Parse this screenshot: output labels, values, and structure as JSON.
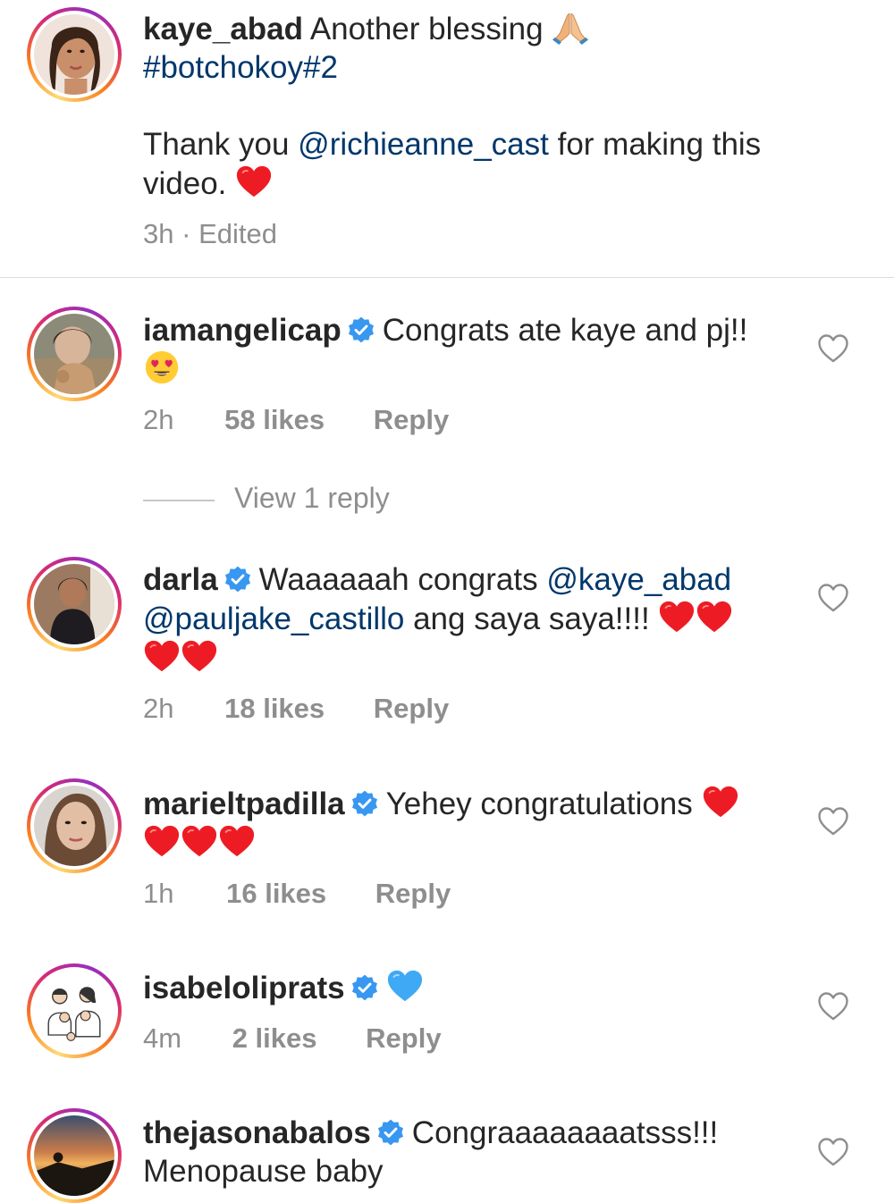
{
  "caption": {
    "username": "kaye_abad",
    "text": "Another blessing",
    "emoji": "folded-hands",
    "hashtag": "#botchokoy#2",
    "thanks_prefix": "Thank you",
    "thanks_mention": "@richieanne_cast",
    "thanks_suffix": "for making this",
    "thanks_line2": "video.",
    "thanks_emoji": "red-heart",
    "time": "3h",
    "separator": "·",
    "edited": "Edited"
  },
  "comments": [
    {
      "username": "iamangelicap",
      "verified": true,
      "text": "Congrats ate kaye and pj!!",
      "emojis": [
        "heart-eyes"
      ],
      "time": "2h",
      "likes": "58 likes",
      "reply": "Reply",
      "view_replies": "View 1 reply"
    },
    {
      "username": "darla",
      "verified": true,
      "text_prefix": "Waaaaaah congrats",
      "mention1": "@kaye_abad",
      "mention2": "@pauljake_castillo",
      "text_suffix": "ang saya saya!!!!",
      "emojis": [
        "red-heart",
        "red-heart",
        "red-heart",
        "red-heart"
      ],
      "time": "2h",
      "likes": "18 likes",
      "reply": "Reply"
    },
    {
      "username": "marieltpadilla",
      "verified": true,
      "text": "Yehey congratulations",
      "emojis": [
        "red-heart",
        "red-heart",
        "red-heart",
        "red-heart"
      ],
      "time": "1h",
      "likes": "16 likes",
      "reply": "Reply"
    },
    {
      "username": "isabeloliprats",
      "verified": true,
      "text": "",
      "emojis": [
        "blue-heart"
      ],
      "time": "4m",
      "likes": "2 likes",
      "reply": "Reply"
    },
    {
      "username": "thejasonabalos",
      "verified": true,
      "text": "Congraaaaaaaatsss!!!",
      "text_line2": "Menopause baby"
    }
  ],
  "colors": {
    "link": "#00376b",
    "meta": "#8e8e8e",
    "verified": "#3897f0",
    "heart": "#ed1c24",
    "blue_heart": "#3fa9f5"
  }
}
